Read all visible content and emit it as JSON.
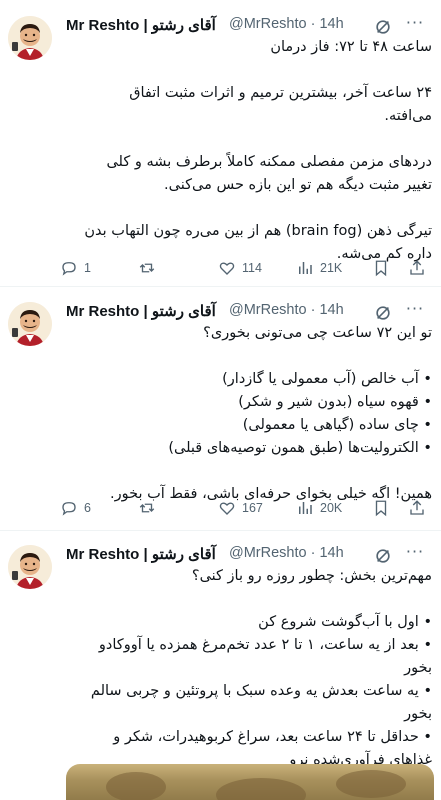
{
  "author": {
    "name": "Mr Reshto | آقای رشتو",
    "handle": "@MrReshto",
    "separator": "·",
    "avatar_icon": "cartoon-man-with-mustache-avatar"
  },
  "tweets": [
    {
      "time": "14h",
      "lines": [
        "ساعت ۴۸ تا ۷۲: فاز درمان",
        "",
        "۲۴ ساعت آخر، بیشترین ترمیم و اثرات مثبت اتفاق",
        "می‌افته.",
        "",
        "دردهای مزمن مفصلی ممکنه کاملاً برطرف بشه و کلی",
        "تغییر مثبت دیگه هم تو این بازه حس می‌کنی.",
        "",
        "تیرگی ذهن (brain fog) هم از بین می‌ره چون التهاب بدن",
        "داره کم می‌شه."
      ],
      "replies": "1",
      "retweets": "",
      "likes": "114",
      "views": "21K"
    },
    {
      "time": "14h",
      "lines": [
        "تو این ۷۲ ساعت چی می‌تونی بخوری؟",
        "",
        "• آب خالص (آب معمولی یا گازدار)",
        "• قهوه سیاه (بدون شیر و شکر)",
        "• چای ساده (گیاهی یا معمولی)",
        "• الکترولیت‌ها (طبق همون توصیه‌های قبلی)",
        "",
        "همین! اگه خیلی بخوای حرفه‌ای باشی، فقط آب بخور."
      ],
      "replies": "6",
      "retweets": "",
      "likes": "167",
      "views": "20K"
    },
    {
      "time": "14h",
      "lines": [
        "مهم‌ترین بخش: چطور روزه رو باز کنی؟",
        "",
        "• اول با آب‌گوشت شروع کن",
        "• بعد از یه ساعت، ۱ تا ۲ عدد تخم‌مرغ همزده یا آووکادو",
        "بخور",
        "• یه ساعت بعدش یه وعده سبک با پروتئین و چربی سالم",
        "بخور",
        "• حداقل تا ۲۴ ساعت بعد، سراغ کربوهیدرات، شکر و",
        "غذاهای فرآوری‌شده نرو"
      ]
    }
  ],
  "colors": {
    "text": "#0f1419",
    "secondary": "#536471",
    "divider": "#eff3f4"
  },
  "icons": {
    "grok": "grok-icon",
    "more": "more-icon",
    "reply": "reply-icon",
    "retweet": "retweet-icon",
    "like": "heart-icon",
    "views": "views-chart-icon",
    "bookmark": "bookmark-icon",
    "share": "share-icon"
  }
}
